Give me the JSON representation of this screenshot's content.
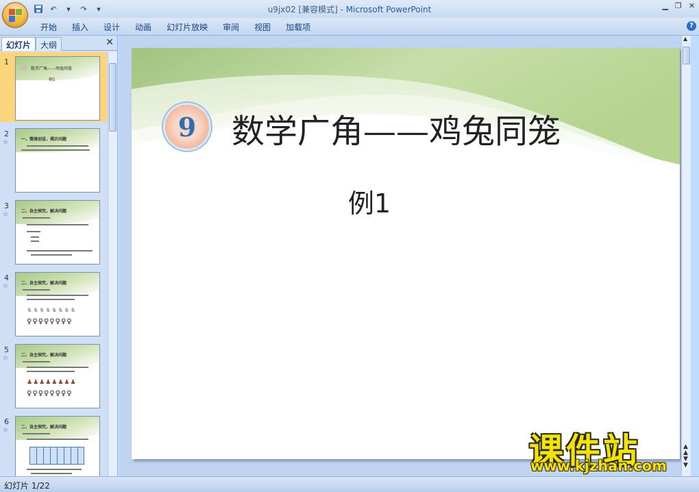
{
  "window": {
    "title_file": "u9jx02 [兼容模式]",
    "title_sep": " - ",
    "title_app": "Microsoft PowerPoint",
    "controls": [
      "minimize",
      "restore",
      "close"
    ]
  },
  "quick_access": {
    "icons": [
      "save-icon",
      "undo-icon",
      "redo-icon",
      "customize-icon"
    ]
  },
  "ribbon": {
    "tabs": [
      "开始",
      "插入",
      "设计",
      "动画",
      "幻灯片放映",
      "审阅",
      "视图",
      "加载项"
    ],
    "help": "?"
  },
  "left_panel": {
    "tab_slides": "幻灯片",
    "tab_outline": "大纲",
    "close": "✕",
    "slides": [
      {
        "num": "1",
        "title": "数学广角——鸡兔同笼",
        "sub": "例1",
        "selected": true
      },
      {
        "num": "2",
        "title": "一、情境创设，揭示问题"
      },
      {
        "num": "3",
        "title": "二、自主探究，解决问题"
      },
      {
        "num": "4",
        "title": "二、自主探究，解决问题"
      },
      {
        "num": "5",
        "title": "二、自主探究，解决问题"
      },
      {
        "num": "6",
        "title": "二、自主探究，解决问题"
      }
    ]
  },
  "slide": {
    "badge": "9",
    "title": "数学广角——鸡兔同笼",
    "subtitle": "例1"
  },
  "watermark": {
    "text": "课件站",
    "url": "www.kjzhan.com"
  },
  "status": {
    "slide_info": "幻灯片 1/22"
  },
  "colors": {
    "accent": "#15428b",
    "selected_slide": "#fbd47c",
    "slide_band": "#a9c98a"
  }
}
